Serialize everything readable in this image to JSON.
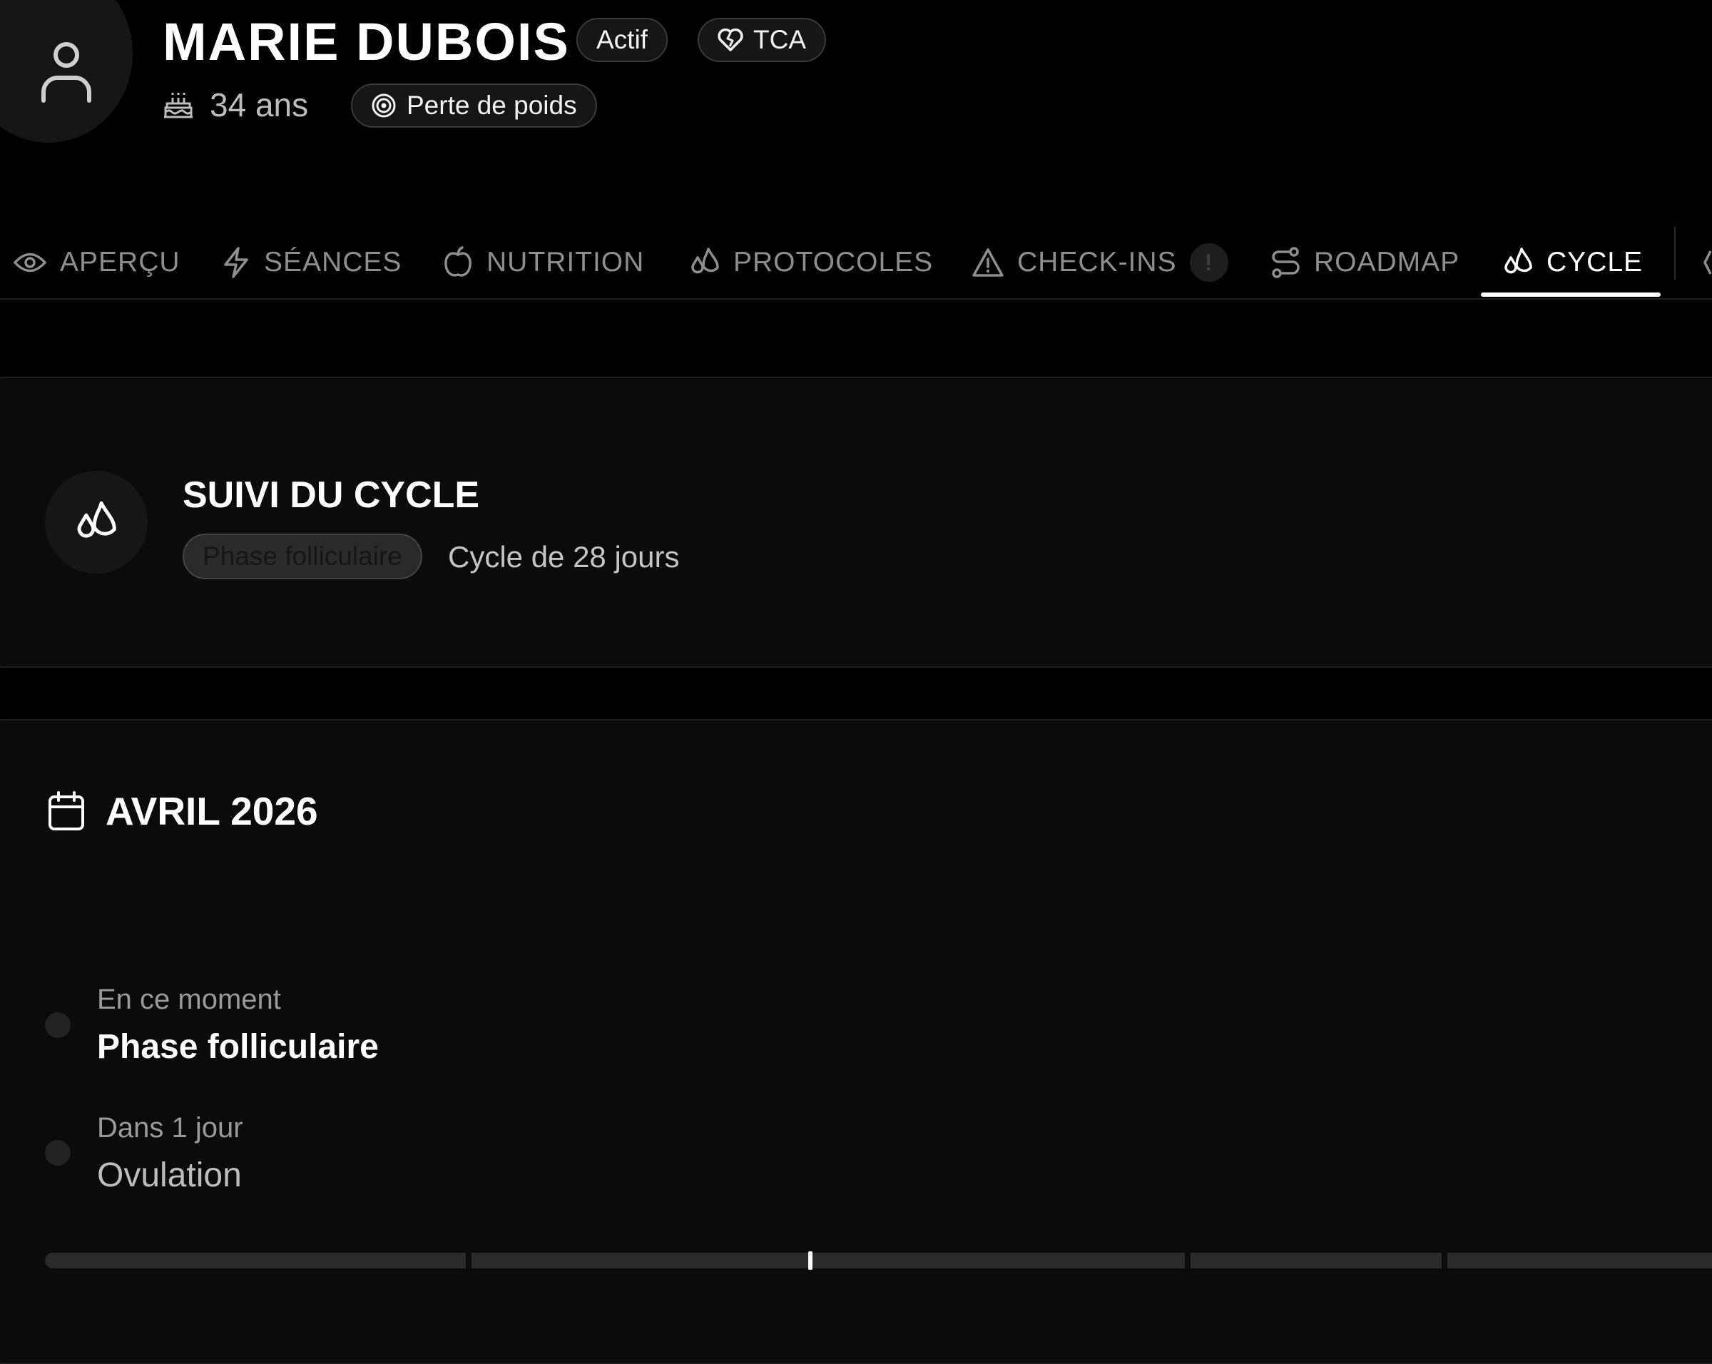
{
  "client": {
    "name": "MARIE DUBOIS",
    "status": "Actif",
    "tag": "TCA",
    "age": "34 ans",
    "goal": "Perte de poids"
  },
  "tabs": [
    {
      "label": "APERÇU",
      "icon": "eye-icon"
    },
    {
      "label": "SÉANCES",
      "icon": "bolt-icon"
    },
    {
      "label": "NUTRITION",
      "icon": "apple-icon"
    },
    {
      "label": "PROTOCOLES",
      "icon": "droplets-icon"
    },
    {
      "label": "CHECK-INS",
      "icon": "warning-icon",
      "badge": "!"
    },
    {
      "label": "ROADMAP",
      "icon": "route-icon"
    },
    {
      "label": "CYCLE",
      "icon": "droplets-icon",
      "active": true
    }
  ],
  "cycle_card": {
    "title": "SUIVI DU CYCLE",
    "phase": "Phase folliculaire",
    "length": "Cycle de 28 jours"
  },
  "calendar": {
    "month": "AVRIL 2026",
    "events": [
      {
        "when": "En ce moment",
        "phase": "Phase folliculaire"
      },
      {
        "when": "Dans 1 jour",
        "phase": "Ovulation"
      }
    ]
  },
  "colors": {
    "background": "#000000",
    "card": "#0b0b0b",
    "active_tab": "#ffffff",
    "inactive_tab": "#8e8e8e"
  }
}
